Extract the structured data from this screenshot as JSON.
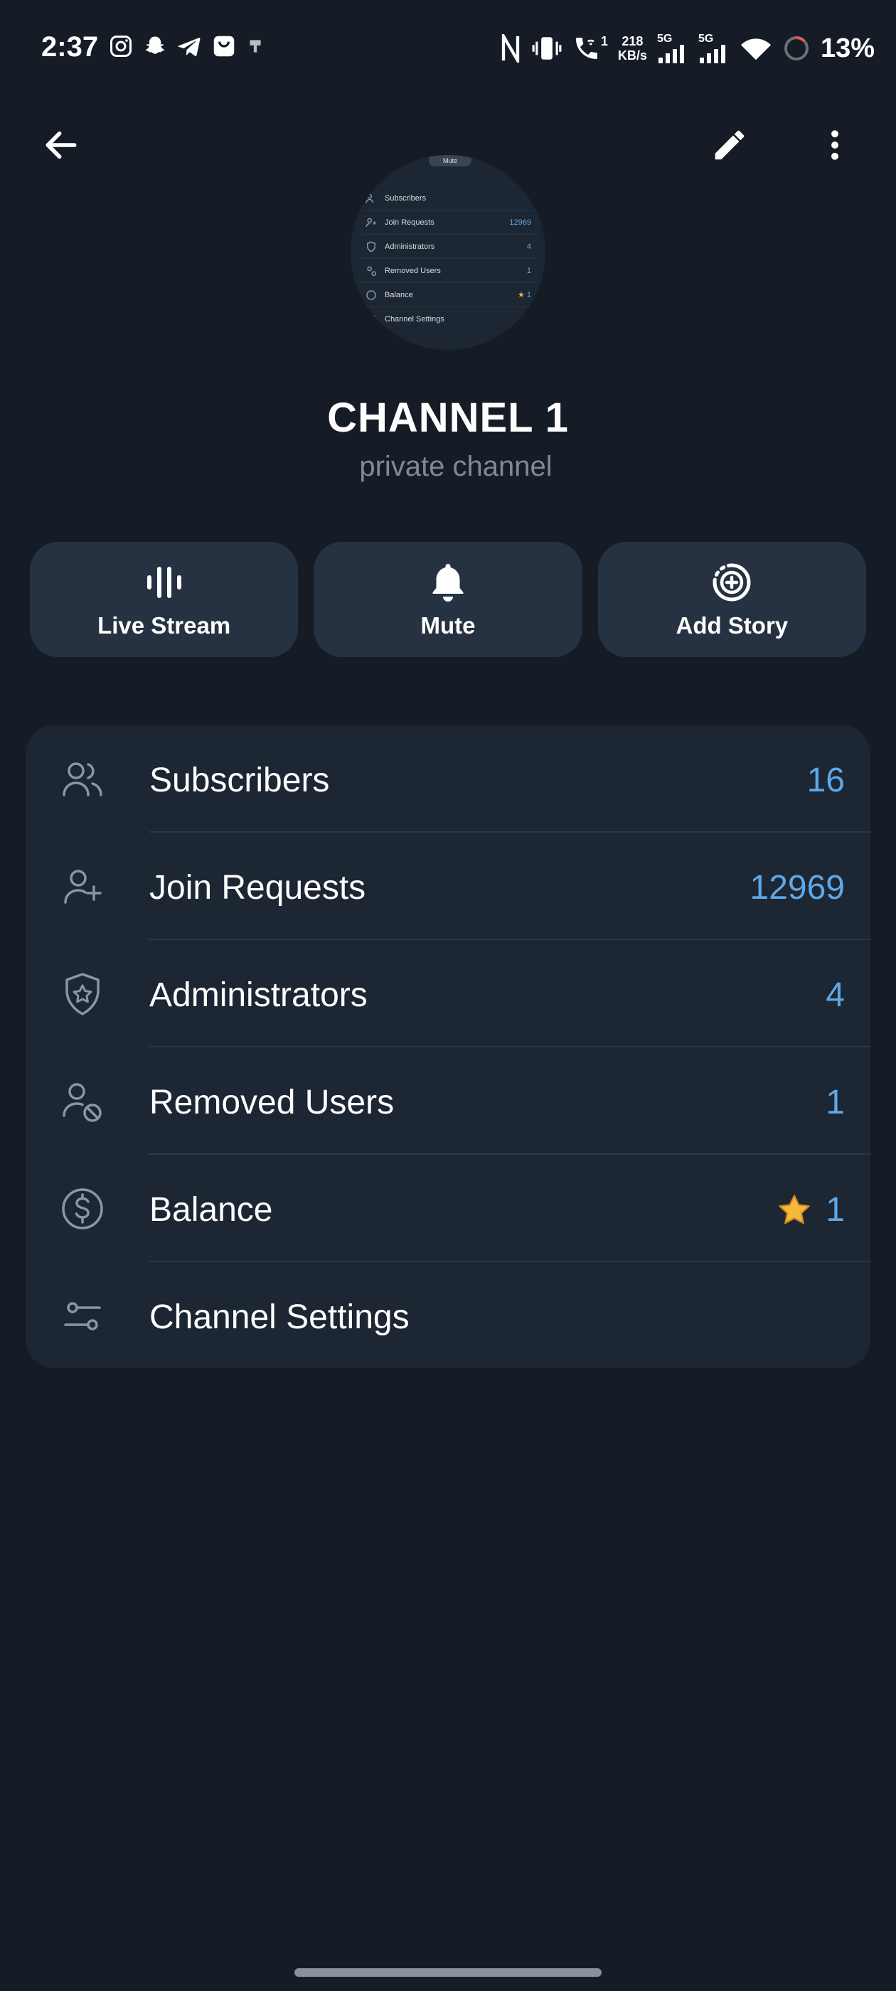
{
  "status_bar": {
    "time": "2:37",
    "network_speed_value": "218",
    "network_speed_unit": "KB/s",
    "call_wifi_label": "1",
    "sim1_label": "5G",
    "sim2_label": "5G",
    "battery_percent": "13%"
  },
  "avatar_preview": {
    "tab_label": "Mute",
    "rows": [
      {
        "label": "Subscribers",
        "value": ""
      },
      {
        "label": "Join Requests",
        "value": "12969"
      },
      {
        "label": "Administrators",
        "value": "4"
      },
      {
        "label": "Removed Users",
        "value": "1"
      },
      {
        "label": "Balance",
        "value": "1"
      },
      {
        "label": "Channel Settings",
        "value": ""
      }
    ]
  },
  "channel": {
    "title": "CHANNEL 1",
    "subtitle": "private channel"
  },
  "actions": [
    {
      "label": "Live Stream",
      "icon": "live-stream-icon"
    },
    {
      "label": "Mute",
      "icon": "bell-icon"
    },
    {
      "label": "Add Story",
      "icon": "add-story-icon"
    }
  ],
  "menu": {
    "items": [
      {
        "label": "Subscribers",
        "value": "16",
        "icon": "subscribers-icon"
      },
      {
        "label": "Join Requests",
        "value": "12969",
        "icon": "add-user-icon"
      },
      {
        "label": "Administrators",
        "value": "4",
        "icon": "shield-star-icon"
      },
      {
        "label": "Removed Users",
        "value": "1",
        "icon": "user-block-icon"
      },
      {
        "label": "Balance",
        "value": "1",
        "icon": "dollar-icon",
        "badge_icon": "star-icon"
      },
      {
        "label": "Channel Settings",
        "value": "",
        "icon": "settings-sliders-icon"
      }
    ]
  },
  "colors": {
    "background": "#161c26",
    "card": "#1d2633",
    "button": "#263241",
    "accent": "#5fa8e6",
    "muted_text": "#7e8a98",
    "star": "#f5b93a"
  }
}
